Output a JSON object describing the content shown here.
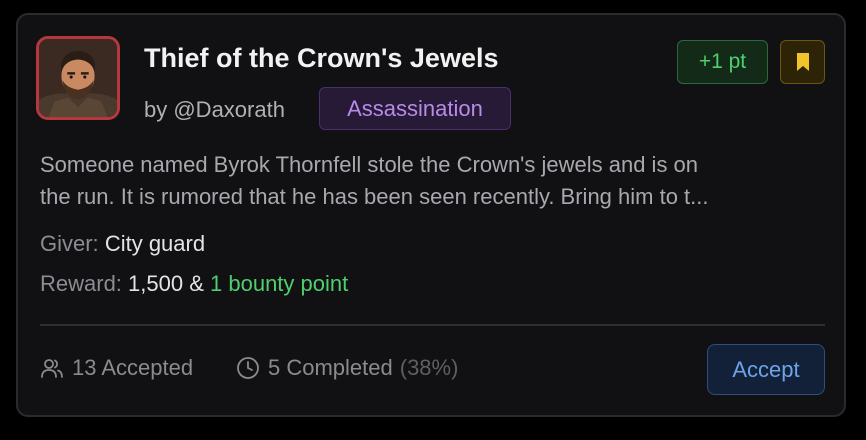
{
  "quest": {
    "title": "Thief of the Crown's Jewels",
    "author": "by @Daxorath",
    "category": "Assassination",
    "points_badge": "+1 pt",
    "description_lines": [
      "Someone named Byrok Thornfell stole the Crown's jewels and is on",
      "the run. It is rumored that he has been seen recently. Bring him to t..."
    ],
    "giver_label": "Giver:",
    "giver_value": "City guard",
    "reward_label": "Reward:",
    "reward_value": "1,500 &",
    "reward_bonus": "1 bounty point",
    "accepted": "13 Accepted",
    "completed": "5 Completed",
    "completed_pct": "(38%)",
    "accept_label": "Accept"
  },
  "colors": {
    "background": "#111113",
    "avatar_border": "#b5383c",
    "tag_purple": "#b88be8",
    "points_green": "#4fce6e",
    "bookmark_gold": "#f0c42a",
    "accept_blue": "#6ea3ea"
  },
  "icons": {
    "bookmark": "bookmark-icon",
    "accepted": "users-icon",
    "completed": "clock-icon"
  }
}
